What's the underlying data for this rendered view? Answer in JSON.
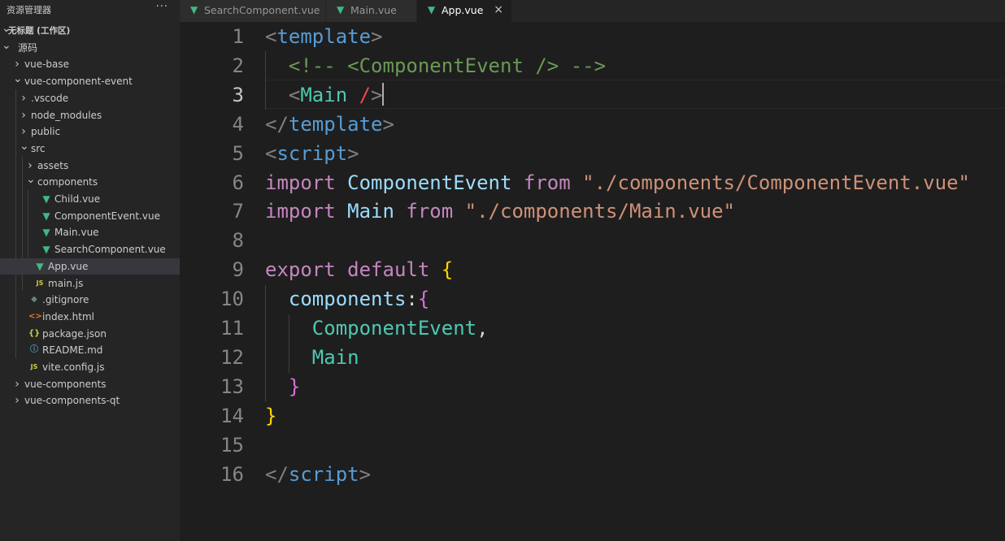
{
  "sidebar": {
    "title": "资源管理器",
    "more_icon": "ellipsis-icon",
    "tree": [
      {
        "label": "无标题 (工作区)",
        "depth": 0,
        "chevron": "down",
        "icon": null,
        "bold": true
      },
      {
        "label": "源码",
        "depth": 0,
        "chevron": "down",
        "icon": null
      },
      {
        "label": "vue-base",
        "depth": 1,
        "chevron": "right",
        "icon": null
      },
      {
        "label": "vue-component-event",
        "depth": 1,
        "chevron": "down",
        "icon": null
      },
      {
        "label": ".vscode",
        "depth": 2,
        "chevron": "right",
        "icon": null
      },
      {
        "label": "node_modules",
        "depth": 2,
        "chevron": "right",
        "icon": null
      },
      {
        "label": "public",
        "depth": 2,
        "chevron": "right",
        "icon": null
      },
      {
        "label": "src",
        "depth": 2,
        "chevron": "down",
        "icon": null
      },
      {
        "label": "assets",
        "depth": 3,
        "chevron": "right",
        "icon": null
      },
      {
        "label": "components",
        "depth": 3,
        "chevron": "down",
        "icon": null
      },
      {
        "label": "Child.vue",
        "depth": 4,
        "chevron": null,
        "icon": "vue"
      },
      {
        "label": "ComponentEvent.vue",
        "depth": 4,
        "chevron": null,
        "icon": "vue"
      },
      {
        "label": "Main.vue",
        "depth": 4,
        "chevron": null,
        "icon": "vue"
      },
      {
        "label": "SearchComponent.vue",
        "depth": 4,
        "chevron": null,
        "icon": "vue"
      },
      {
        "label": "App.vue",
        "depth": 3,
        "chevron": null,
        "icon": "vue",
        "selected": true
      },
      {
        "label": "main.js",
        "depth": 3,
        "chevron": null,
        "icon": "js"
      },
      {
        "label": ".gitignore",
        "depth": 2,
        "chevron": null,
        "icon": "git"
      },
      {
        "label": "index.html",
        "depth": 2,
        "chevron": null,
        "icon": "html"
      },
      {
        "label": "package.json",
        "depth": 2,
        "chevron": null,
        "icon": "json"
      },
      {
        "label": "README.md",
        "depth": 2,
        "chevron": null,
        "icon": "info"
      },
      {
        "label": "vite.config.js",
        "depth": 2,
        "chevron": null,
        "icon": "js"
      },
      {
        "label": "vue-components",
        "depth": 1,
        "chevron": "right",
        "icon": null
      },
      {
        "label": "vue-components-qt",
        "depth": 1,
        "chevron": "right",
        "icon": null
      }
    ]
  },
  "icon_glyphs": {
    "vue": "▼",
    "js": "JS",
    "html": "<>",
    "json": "{}",
    "info": "ⓘ",
    "git": "◆"
  },
  "tabs": [
    {
      "label": "SearchComponent.vue",
      "active": false
    },
    {
      "label": "Main.vue",
      "active": false
    },
    {
      "label": "App.vue",
      "active": true,
      "close": "×"
    }
  ],
  "editor": {
    "current_line": 3,
    "lines": [
      {
        "n": "1",
        "tokens": [
          [
            "t-punct",
            "<"
          ],
          [
            "t-tag",
            "template"
          ],
          [
            "t-punct",
            ">"
          ]
        ]
      },
      {
        "n": "2",
        "tokens": [
          [
            "t-plain",
            "  "
          ],
          [
            "t-comment",
            "<!-- <ComponentEvent /> -->"
          ]
        ]
      },
      {
        "n": "3",
        "tokens": [
          [
            "t-plain",
            "  "
          ],
          [
            "t-punct",
            "<"
          ],
          [
            "t-class",
            "Main"
          ],
          [
            "t-plain",
            " "
          ],
          [
            "t-red",
            "/"
          ],
          [
            "t-punct",
            ">"
          ]
        ]
      },
      {
        "n": "4",
        "tokens": [
          [
            "t-punct",
            "</"
          ],
          [
            "t-tag",
            "template"
          ],
          [
            "t-punct",
            ">"
          ]
        ]
      },
      {
        "n": "5",
        "tokens": [
          [
            "t-punct",
            "<"
          ],
          [
            "t-tag",
            "script"
          ],
          [
            "t-punct",
            ">"
          ]
        ]
      },
      {
        "n": "6",
        "tokens": [
          [
            "t-kw",
            "import"
          ],
          [
            "t-plain",
            " "
          ],
          [
            "t-var",
            "ComponentEvent"
          ],
          [
            "t-plain",
            " "
          ],
          [
            "t-kw",
            "from"
          ],
          [
            "t-plain",
            " "
          ],
          [
            "t-str",
            "\"./components/ComponentEvent.vue\""
          ]
        ]
      },
      {
        "n": "7",
        "tokens": [
          [
            "t-kw",
            "import"
          ],
          [
            "t-plain",
            " "
          ],
          [
            "t-var",
            "Main"
          ],
          [
            "t-plain",
            " "
          ],
          [
            "t-kw",
            "from"
          ],
          [
            "t-plain",
            " "
          ],
          [
            "t-str",
            "\"./components/Main.vue\""
          ]
        ]
      },
      {
        "n": "8",
        "tokens": []
      },
      {
        "n": "9",
        "tokens": [
          [
            "t-kw",
            "export"
          ],
          [
            "t-plain",
            " "
          ],
          [
            "t-kw",
            "default"
          ],
          [
            "t-plain",
            " "
          ],
          [
            "t-brace",
            "{"
          ]
        ]
      },
      {
        "n": "10",
        "tokens": [
          [
            "t-plain",
            "  "
          ],
          [
            "t-var",
            "components"
          ],
          [
            "t-plain",
            ":"
          ],
          [
            "t-brace2",
            "{"
          ]
        ]
      },
      {
        "n": "11",
        "tokens": [
          [
            "t-plain",
            "    "
          ],
          [
            "t-class",
            "ComponentEvent"
          ],
          [
            "t-plain",
            ","
          ]
        ]
      },
      {
        "n": "12",
        "tokens": [
          [
            "t-plain",
            "    "
          ],
          [
            "t-class",
            "Main"
          ]
        ]
      },
      {
        "n": "13",
        "tokens": [
          [
            "t-plain",
            "  "
          ],
          [
            "t-brace2",
            "}"
          ]
        ]
      },
      {
        "n": "14",
        "tokens": [
          [
            "t-brace",
            "}"
          ]
        ]
      },
      {
        "n": "15",
        "tokens": []
      },
      {
        "n": "16",
        "tokens": [
          [
            "t-punct",
            "</"
          ],
          [
            "t-tag",
            "script"
          ],
          [
            "t-punct",
            ">"
          ]
        ]
      }
    ]
  }
}
